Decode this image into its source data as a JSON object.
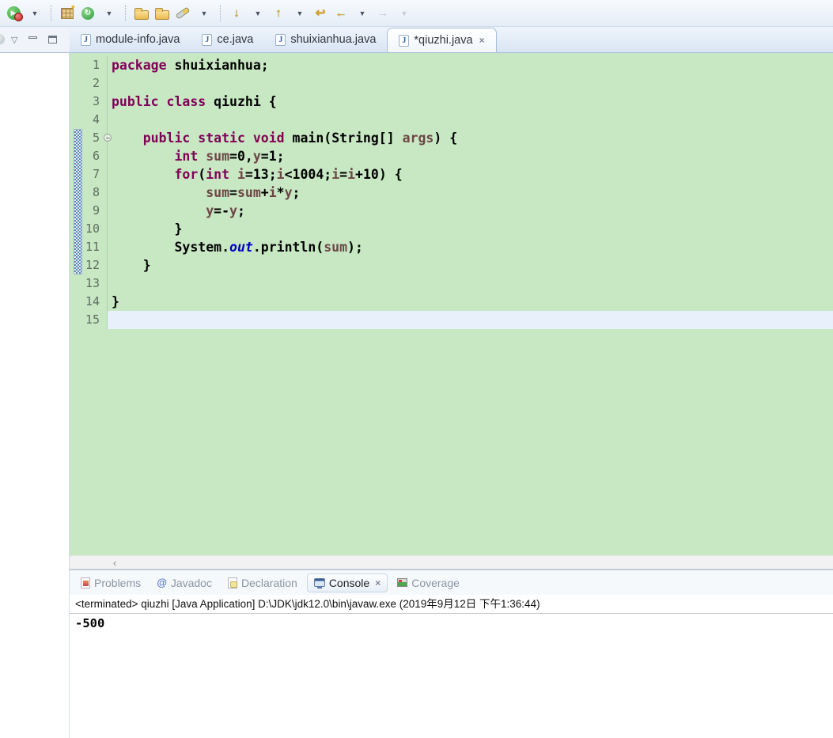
{
  "toolbar": {
    "buttons": [
      "run-button",
      "new-java-package-button",
      "coverage-button",
      "open-folder-button",
      "open-folder-alt-button",
      "search-button",
      "next-annotation-button",
      "previous-annotation-button",
      "last-edit-location-button",
      "back-button",
      "forward-button"
    ]
  },
  "editor_tabs": [
    {
      "label": "module-info.java",
      "active": false
    },
    {
      "label": "ce.java",
      "active": false
    },
    {
      "label": "shuixianhua.java",
      "active": false
    },
    {
      "label": "*qiuzhi.java",
      "active": true,
      "close_label": "✕"
    }
  ],
  "editor": {
    "lines": [
      {
        "num": "1",
        "tokens": [
          [
            "k",
            "package"
          ],
          [
            "p",
            " shuixianhua;"
          ]
        ]
      },
      {
        "num": "2",
        "tokens": []
      },
      {
        "num": "3",
        "tokens": [
          [
            "k",
            "public"
          ],
          [
            "p",
            " "
          ],
          [
            "k",
            "class"
          ],
          [
            "p",
            " qiuzhi {"
          ]
        ]
      },
      {
        "num": "4",
        "tokens": []
      },
      {
        "num": "5",
        "fold": true,
        "tokens": [
          [
            "p",
            "    "
          ],
          [
            "k",
            "public"
          ],
          [
            "p",
            " "
          ],
          [
            "k",
            "static"
          ],
          [
            "p",
            " "
          ],
          [
            "k",
            "void"
          ],
          [
            "p",
            " main(String[] "
          ],
          [
            "v",
            "args"
          ],
          [
            "p",
            ") {"
          ]
        ]
      },
      {
        "num": "6",
        "tokens": [
          [
            "p",
            "        "
          ],
          [
            "k",
            "int"
          ],
          [
            "p",
            " "
          ],
          [
            "v",
            "sum"
          ],
          [
            "p",
            "=0,"
          ],
          [
            "v",
            "y"
          ],
          [
            "p",
            "=1;"
          ]
        ]
      },
      {
        "num": "7",
        "tokens": [
          [
            "p",
            "        "
          ],
          [
            "k",
            "for"
          ],
          [
            "p",
            "("
          ],
          [
            "k",
            "int"
          ],
          [
            "p",
            " "
          ],
          [
            "v",
            "i"
          ],
          [
            "p",
            "=13;"
          ],
          [
            "v",
            "i"
          ],
          [
            "p",
            "<1004;"
          ],
          [
            "v",
            "i"
          ],
          [
            "p",
            "="
          ],
          [
            "v",
            "i"
          ],
          [
            "p",
            "+10) {"
          ]
        ]
      },
      {
        "num": "8",
        "tokens": [
          [
            "p",
            "            "
          ],
          [
            "v",
            "sum"
          ],
          [
            "p",
            "="
          ],
          [
            "v",
            "sum"
          ],
          [
            "p",
            "+"
          ],
          [
            "v",
            "i"
          ],
          [
            "p",
            "*"
          ],
          [
            "v",
            "y"
          ],
          [
            "p",
            ";"
          ]
        ]
      },
      {
        "num": "9",
        "tokens": [
          [
            "p",
            "            "
          ],
          [
            "v",
            "y"
          ],
          [
            "p",
            "=-"
          ],
          [
            "v",
            "y"
          ],
          [
            "p",
            ";"
          ]
        ]
      },
      {
        "num": "10",
        "tokens": [
          [
            "p",
            "        }"
          ]
        ]
      },
      {
        "num": "11",
        "tokens": [
          [
            "p",
            "        System."
          ],
          [
            "f",
            "out"
          ],
          [
            "p",
            ".println("
          ],
          [
            "v",
            "sum"
          ],
          [
            "p",
            ");"
          ]
        ]
      },
      {
        "num": "12",
        "tokens": [
          [
            "p",
            "    }"
          ]
        ]
      },
      {
        "num": "13",
        "tokens": []
      },
      {
        "num": "14",
        "tokens": [
          [
            "p",
            "}"
          ]
        ]
      },
      {
        "num": "15",
        "current": true,
        "tokens": []
      }
    ],
    "range_indicator_lines": [
      5,
      12
    ]
  },
  "scrollbar": {
    "left_arrow": "‹"
  },
  "bottom_tabs": [
    {
      "label": "Problems",
      "icon": "problems",
      "active": false
    },
    {
      "label": "Javadoc",
      "icon": "javadoc",
      "active": false
    },
    {
      "label": "Declaration",
      "icon": "declaration",
      "active": false
    },
    {
      "label": "Console",
      "icon": "console",
      "active": true,
      "close_label": "✕"
    },
    {
      "label": "Coverage",
      "icon": "coverage",
      "active": false
    }
  ],
  "console": {
    "title": "<terminated> qiuzhi [Java Application] D:\\JDK\\jdk12.0\\bin\\javaw.exe (2019年9月12日 下午1:36:44)",
    "output": "-500"
  },
  "colors": {
    "editor_background": "#c8e8c4",
    "current_line_highlight": "#e8f1fb",
    "keyword": "#7f0055",
    "variable": "#6d4545",
    "field": "#0000c0",
    "range_indicator": "#5a86b8"
  }
}
